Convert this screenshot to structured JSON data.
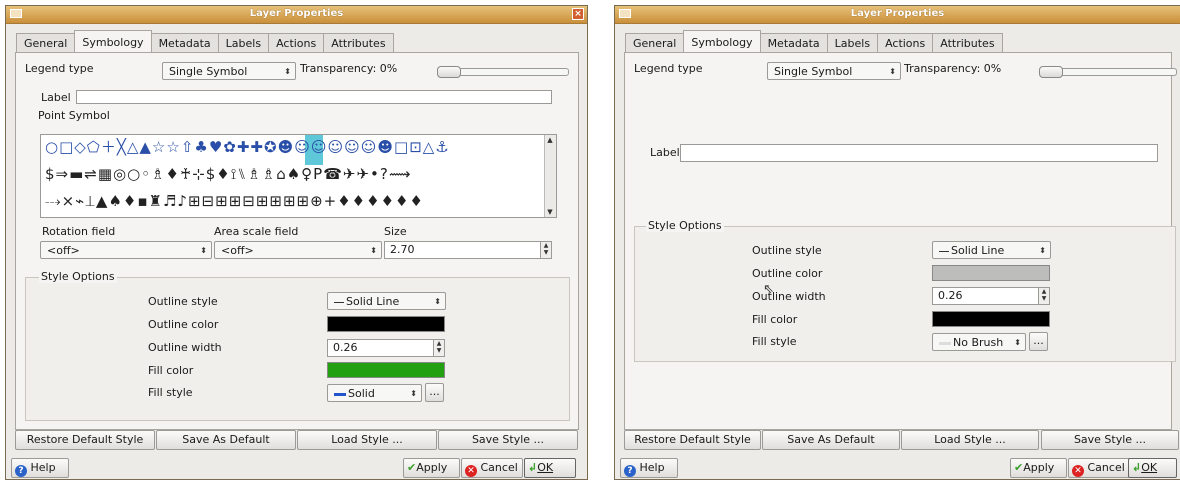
{
  "left": {
    "title": "Layer Properties",
    "tabs": [
      "General",
      "Symbology",
      "Metadata",
      "Labels",
      "Actions",
      "Attributes"
    ],
    "legend_type_label": "Legend type",
    "legend_type_value": "Single Symbol",
    "transparency_label": "Transparency: 0%",
    "label_label": "Label",
    "label_value": "",
    "point_symbol_label": "Point Symbol",
    "symbol_rows": [
      "○□◇⬠＋╳△▲☆☆⇧♣♥✿✚✚✪☻☺☺☺☺☺☻□⊡△⚓",
      "$⇒▬⇌▦◎○◦♗♦♰⊹$♦⟟⑊♗♗⌂♠♀P☎✈✈•?⟿",
      "⤏⨯⌁⟂▲♠♦▪♜♬♪⊞⊟⊞⊞⊟⊞⊞⊞⊞⊕+♦♦♦♦♦♦"
    ],
    "rotation_field_label": "Rotation field",
    "area_scale_field_label": "Area scale field",
    "size_label": "Size",
    "rotation_field_value": "<off>",
    "area_scale_field_value": "<off>",
    "size_value": "2.70",
    "style_options_label": "Style Options",
    "outline_style_label": "Outline style",
    "outline_style_value": "Solid Line",
    "outline_color_label": "Outline color",
    "outline_color": "#000000",
    "outline_width_label": "Outline width",
    "outline_width_value": "0.26",
    "fill_color_label": "Fill color",
    "fill_color": "#23a012",
    "fill_style_label": "Fill style",
    "fill_style_value": "Solid",
    "ellipsis": "...",
    "restore_default": "Restore Default Style",
    "save_as_default": "Save As Default",
    "load_style": "Load Style ...",
    "save_style": "Save Style ...",
    "help": "Help",
    "apply": "Apply",
    "cancel": "Cancel",
    "ok": "OK"
  },
  "right": {
    "title": "Layer Properties",
    "tabs": [
      "General",
      "Symbology",
      "Metadata",
      "Labels",
      "Actions",
      "Attributes"
    ],
    "legend_type_label": "Legend type",
    "legend_type_value": "Single Symbol",
    "transparency_label": "Transparency: 0%",
    "label_label": "Label",
    "label_value": "",
    "style_options_label": "Style Options",
    "outline_style_label": "Outline style",
    "outline_style_value": "Solid Line",
    "outline_color_label": "Outline color",
    "outline_color": "#bdbdbb",
    "outline_width_label": "Outline width",
    "outline_width_value": "0.26",
    "fill_color_label": "Fill color",
    "fill_color": "#000000",
    "fill_style_label": "Fill style",
    "fill_style_value": "No Brush",
    "ellipsis": "...",
    "restore_default": "Restore Default Style",
    "save_as_default": "Save As Default",
    "load_style": "Load Style ...",
    "save_style": "Save Style ...",
    "help": "Help",
    "apply": "Apply",
    "cancel": "Cancel",
    "ok": "OK"
  }
}
